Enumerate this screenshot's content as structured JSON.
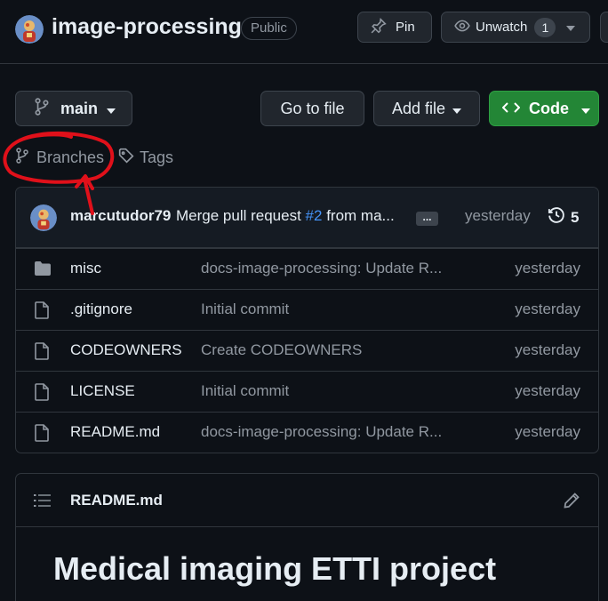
{
  "header": {
    "repo_name": "image-processing",
    "visibility": "Public",
    "pin_label": "Pin",
    "watch_label": "Unwatch",
    "watch_count": "1"
  },
  "toolbar": {
    "branch": "main",
    "goto_file": "Go to file",
    "add_file": "Add file",
    "code": "Code",
    "branches": "Branches",
    "tags": "Tags"
  },
  "commit": {
    "author": "marcutudor79",
    "message_prefix": "Merge pull request",
    "pr": "#2",
    "message_suffix": "from ma...",
    "ellipsis": "...",
    "time": "yesterday",
    "history_count": "5"
  },
  "files": [
    {
      "name": "misc",
      "type": "folder",
      "message": "docs-image-processing: Update R...",
      "time": "yesterday"
    },
    {
      "name": ".gitignore",
      "type": "file",
      "message": "Initial commit",
      "time": "yesterday"
    },
    {
      "name": "CODEOWNERS",
      "type": "file",
      "message": "Create CODEOWNERS",
      "time": "yesterday"
    },
    {
      "name": "LICENSE",
      "type": "file",
      "message": "Initial commit",
      "time": "yesterday"
    },
    {
      "name": "README.md",
      "type": "file",
      "message": "docs-image-processing: Update R...",
      "time": "yesterday"
    }
  ],
  "readme": {
    "title": "README.md",
    "heading": "Medical imaging ETTI project"
  },
  "colors": {
    "background": "#0d1117",
    "accent_green": "#238636",
    "link_blue": "#4493f8",
    "annotation_red": "#e0101a"
  }
}
